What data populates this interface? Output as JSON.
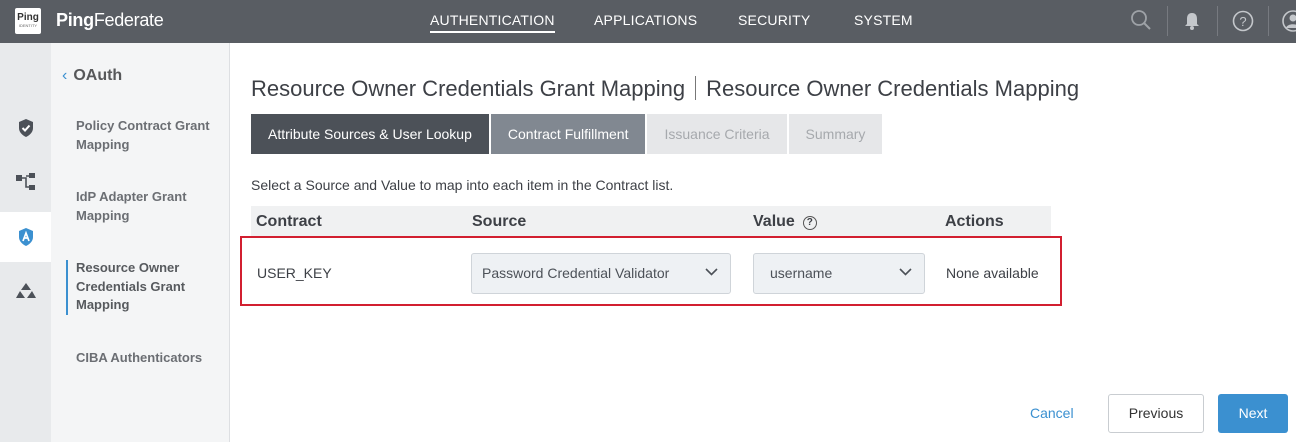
{
  "header": {
    "logo_text": "Ping",
    "logo_subtext": "IDENTITY",
    "brand_prefix": "Ping",
    "brand_suffix": "Federate",
    "nav": [
      "AUTHENTICATION",
      "APPLICATIONS",
      "SECURITY",
      "SYSTEM"
    ],
    "active_nav": "AUTHENTICATION"
  },
  "rail": {
    "items": [
      "shield-icon",
      "flow-icon",
      "oauth-icon",
      "network-icon"
    ],
    "active": "oauth-icon"
  },
  "sidebar": {
    "back_label": "OAuth",
    "items": [
      {
        "label": "Policy Contract Grant Mapping"
      },
      {
        "label": "IdP Adapter Grant Mapping"
      },
      {
        "label": "Resource Owner Credentials Grant Mapping"
      },
      {
        "label": "CIBA Authenticators"
      }
    ],
    "active_index": 2
  },
  "main": {
    "title_left": "Resource Owner Credentials Grant Mapping",
    "title_right": "Resource Owner Credentials Mapping",
    "tabs": [
      {
        "label": "Attribute Sources & User Lookup",
        "state": "active"
      },
      {
        "label": "Contract Fulfillment",
        "state": "current"
      },
      {
        "label": "Issuance Criteria",
        "state": "disabled"
      },
      {
        "label": "Summary",
        "state": "disabled"
      }
    ],
    "instructions": "Select a Source and Value to map into each item in the Contract list.",
    "table": {
      "headers": {
        "contract": "Contract",
        "source": "Source",
        "value": "Value",
        "actions": "Actions"
      },
      "help_glyph": "?",
      "rows": [
        {
          "contract": "USER_KEY",
          "source": "Password Credential Validator",
          "value": "username",
          "actions": "None available"
        }
      ]
    },
    "buttons": {
      "cancel": "Cancel",
      "previous": "Previous",
      "next": "Next"
    }
  },
  "colors": {
    "topbar": "#595d63",
    "accent": "#3b90d0",
    "highlight": "#d21f30"
  }
}
